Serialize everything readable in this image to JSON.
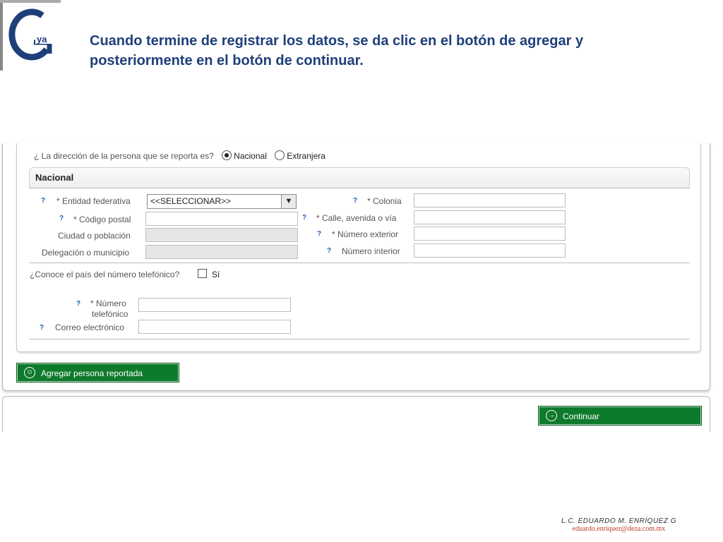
{
  "header": {
    "logo_letters": "Gya",
    "title": "Cuando termine de registrar los datos, se da clic en el botón de agregar y posteriormente en el botón de continuar."
  },
  "form": {
    "address_question": "¿ La dirección de la persona que se reporta es?",
    "options": [
      {
        "label": "Nacional",
        "checked": true
      },
      {
        "label": "Extranjera",
        "checked": false
      }
    ],
    "section_title": "Nacional",
    "help_mark": "?",
    "entidad_label": "* Entidad federativa",
    "entidad_value": "<<SELECCIONAR>>",
    "codigo_postal_label": "* Código postal",
    "ciudad_label": "Ciudad o población",
    "delegacion_label": "Delegación o municipio",
    "colonia_label": "* Colonia",
    "calle_label": "* Calle, avenida o vía",
    "num_ext_label": "* Número exterior",
    "num_int_label": "Número interior",
    "phone_country_question": "¿Conoce el país del número telefónico?",
    "phone_country_checkbox": "Sí",
    "numero_label_1": "* Número",
    "numero_label_2": "telefónico",
    "correo_label": "Correo electrónico",
    "add_button": "Agregar persona reportada",
    "continue_button": "Continuar"
  },
  "footer": {
    "name": "L.C. EDUARDO M. ENRÍQUEZ G",
    "email": "eduardo.enriquez@deza.com.mx"
  },
  "colors": {
    "title": "#1f3f7a",
    "button_green": "#0e7a2c",
    "help_blue": "#1a5fb4"
  }
}
